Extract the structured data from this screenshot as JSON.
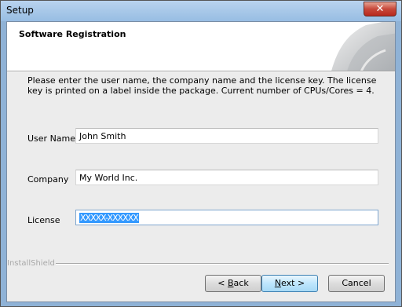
{
  "window": {
    "title": "Setup",
    "close_label": "✕"
  },
  "header": {
    "title": "Software Registration"
  },
  "description": "Please enter the user name, the company name and the license key. The license key is printed on a label inside the package. Current number of CPUs/Cores = 4.",
  "form": {
    "user_name": {
      "label": "User Name",
      "value": "John Smith"
    },
    "company": {
      "label": "Company",
      "value": "My World Inc."
    },
    "license": {
      "label": "License",
      "value": "XXXXX-XXXXXX"
    }
  },
  "footer": {
    "brand": "InstallShield"
  },
  "buttons": {
    "back_prefix": "< ",
    "back_mnemonic": "B",
    "back_rest": "ack",
    "next_mnemonic": "N",
    "next_rest": "ext >",
    "cancel": "Cancel"
  }
}
